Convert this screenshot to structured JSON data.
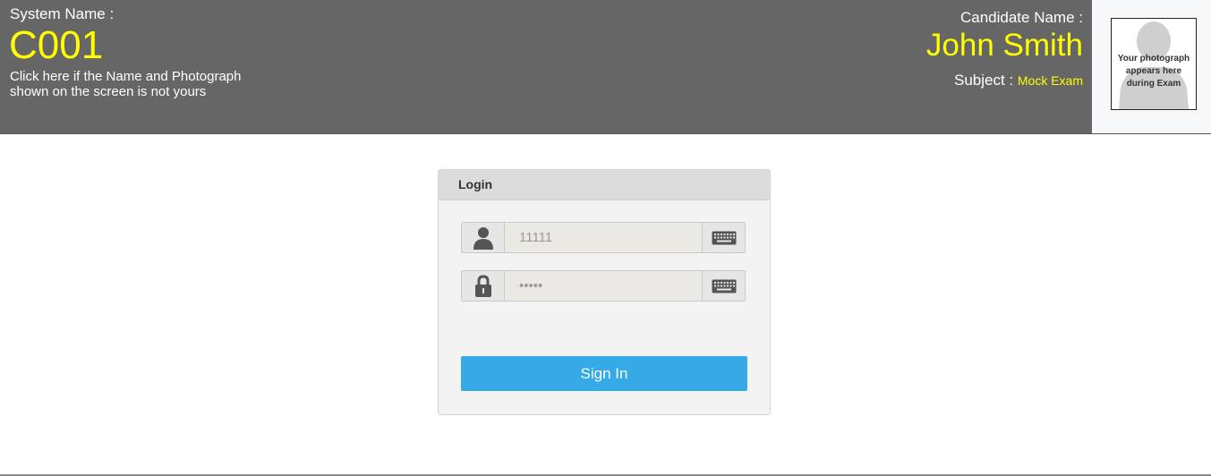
{
  "header": {
    "system_label": "System Name :",
    "system_name": "C001",
    "not_yours_link": "Click here if the Name and Photograph shown on the screen is not yours",
    "candidate_label": "Candidate Name :",
    "candidate_name": "John Smith",
    "subject_label": "Subject :",
    "subject_value": "Mock Exam",
    "photo_caption": "Your photograph appears here during Exam"
  },
  "login": {
    "title": "Login",
    "username": {
      "placeholder": "11111",
      "icon": "user-icon",
      "keyboard_icon": "keyboard-icon"
    },
    "password": {
      "placeholder": "•••••",
      "icon": "lock-icon",
      "keyboard_icon": "keyboard-icon"
    },
    "signin_label": "Sign In"
  },
  "colors": {
    "header_bg": "#666666",
    "highlight": "#ffff00",
    "button": "#35aae6"
  }
}
